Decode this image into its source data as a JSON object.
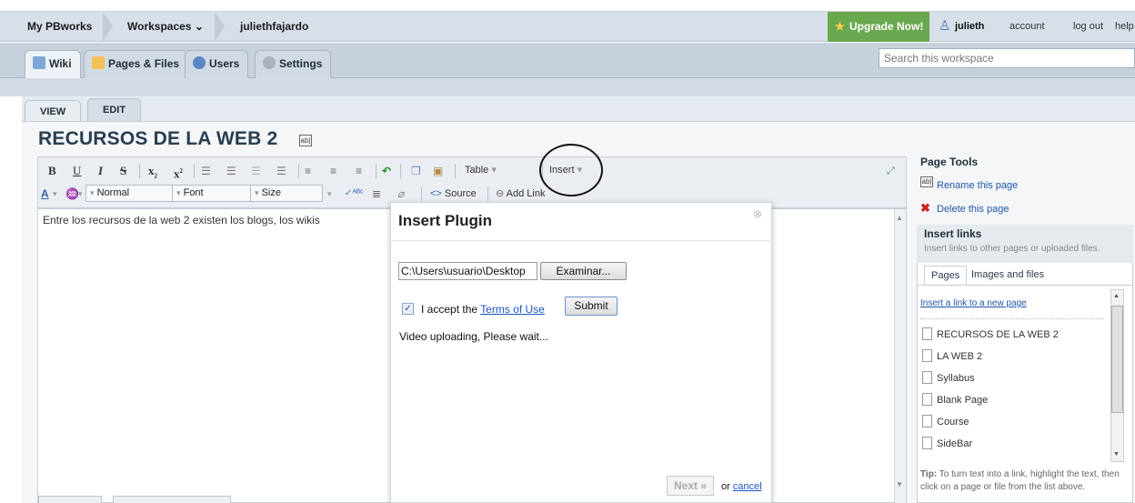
{
  "topbar": {
    "breadcrumbs": [
      "My PBworks",
      "Workspaces",
      "juliethfajardo"
    ],
    "workspaces_caret": "⌄",
    "upgrade": "Upgrade Now!",
    "user": "julieth",
    "account": "account",
    "logout": "log out",
    "help": "help"
  },
  "nav": {
    "tabs": [
      "Wiki",
      "Pages & Files",
      "Users",
      "Settings"
    ],
    "search_placeholder": "Search this workspace"
  },
  "mode_tabs": [
    "VIEW",
    "EDIT"
  ],
  "page_title": "RECURSOS DE LA WEB 2",
  "title_icon_text": "ab|",
  "toolbar": {
    "style_combo": "Normal",
    "font_combo": "Font",
    "size_combo": "Size",
    "table": "Table",
    "insert": "Insert",
    "source": "Source",
    "add_link": "Add Link"
  },
  "editor_text": "Entre los recursos de la web 2 existen los blogs, los wikis",
  "modal": {
    "title": "Insert Plugin",
    "file_path": "C:\\Users\\usuario\\Desktop",
    "browse": "Examinar...",
    "accept_prefix": "I accept the",
    "terms": "Terms of Use",
    "submit": "Submit",
    "status": "Video uploading, Please wait...",
    "next": "Next »",
    "or": "or",
    "cancel": "cancel"
  },
  "sidebar": {
    "page_tools": "Page Tools",
    "rename": "Rename this page",
    "delete": "Delete this page",
    "insert_links": "Insert links",
    "insert_links_desc": "Insert links to other pages or uploaded files.",
    "tabs": [
      "Pages",
      "Images and files"
    ],
    "new_page_link": "Insert a link to a new page",
    "pages": [
      "RECURSOS DE LA WEB 2",
      "LA WEB 2",
      "Syllabus",
      "Blank Page",
      "Course",
      "SideBar"
    ],
    "tip_label": "Tip:",
    "tip": "To turn text into a link, highlight the text, then click on a page or file from the list above."
  }
}
